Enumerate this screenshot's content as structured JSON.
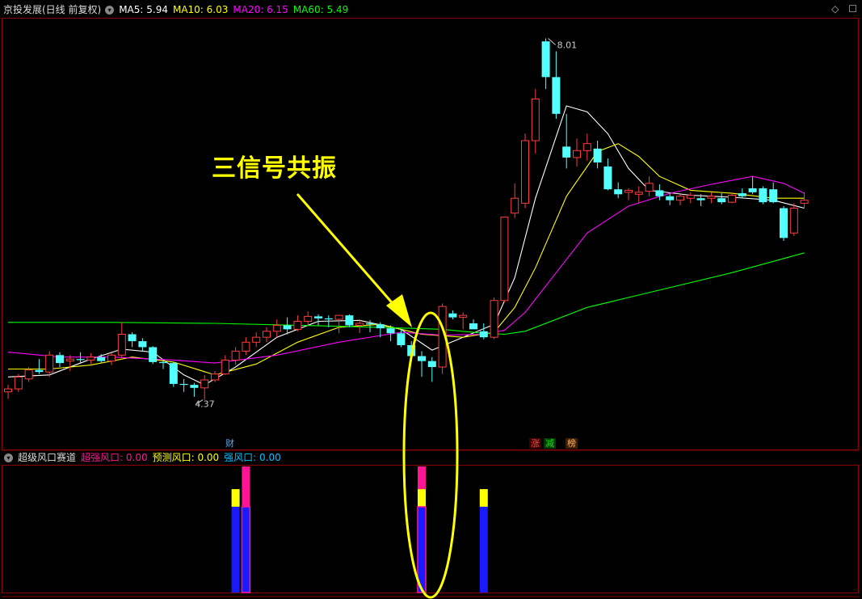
{
  "main_header": {
    "title": "京投发展(日线 前复权)",
    "ma5": "MA5: 5.94",
    "ma10": "MA10: 6.03",
    "ma20": "MA20: 6.15",
    "ma60": "MA60: 5.49"
  },
  "sub_header": {
    "title": "超级风口赛道",
    "s1": "超强风口: 0.00",
    "s2": "预测风口: 0.00",
    "s3": "强风口: 0.00"
  },
  "annotation": "三信号共振",
  "badges": {
    "cai": "财",
    "zhang": "涨",
    "jian": "减",
    "bang": "榜"
  },
  "colors": {
    "up": "#ff3c3c",
    "down": "#54ffff",
    "ma5": "#ffffff",
    "ma10": "#ffff00",
    "ma20": "#ff00ff",
    "ma60": "#00ff00",
    "superStrong": "#ff1493",
    "predict": "#ffff00",
    "strong": "#00bfff",
    "blue": "#1a1aff",
    "ellipse": "#ffff00"
  },
  "chart_data": {
    "type": "candlestick",
    "ylim": [
      4.0,
      8.25
    ],
    "price_labels": {
      "high": "8.01",
      "low": "4.37"
    },
    "candles": [
      [
        4.45,
        4.52,
        4.38,
        4.48
      ],
      [
        4.48,
        4.63,
        4.45,
        4.6
      ],
      [
        4.58,
        4.7,
        4.55,
        4.67
      ],
      [
        4.67,
        4.78,
        4.63,
        4.65
      ],
      [
        4.65,
        4.86,
        4.6,
        4.82
      ],
      [
        4.82,
        4.85,
        4.7,
        4.74
      ],
      [
        4.76,
        4.82,
        4.66,
        4.78
      ],
      [
        4.78,
        4.85,
        4.74,
        4.77
      ],
      [
        4.77,
        4.84,
        4.73,
        4.8
      ],
      [
        4.8,
        4.83,
        4.74,
        4.76
      ],
      [
        4.76,
        4.84,
        4.72,
        4.82
      ],
      [
        4.82,
        5.15,
        4.8,
        5.03
      ],
      [
        5.03,
        5.05,
        4.9,
        4.96
      ],
      [
        4.96,
        4.99,
        4.86,
        4.9
      ],
      [
        4.9,
        4.91,
        4.73,
        4.75
      ],
      [
        4.75,
        4.77,
        4.68,
        4.74
      ],
      [
        4.74,
        4.75,
        4.5,
        4.53
      ],
      [
        4.53,
        4.58,
        4.45,
        4.52
      ],
      [
        4.52,
        4.54,
        4.4,
        4.49
      ],
      [
        4.49,
        4.62,
        4.37,
        4.57
      ],
      [
        4.57,
        4.66,
        4.55,
        4.63
      ],
      [
        4.63,
        4.82,
        4.62,
        4.77
      ],
      [
        4.77,
        4.9,
        4.72,
        4.86
      ],
      [
        4.86,
        5.0,
        4.82,
        4.95
      ],
      [
        4.95,
        5.05,
        4.9,
        5.0
      ],
      [
        5.0,
        5.1,
        4.95,
        5.06
      ],
      [
        5.06,
        5.18,
        5.0,
        5.12
      ],
      [
        5.12,
        5.2,
        5.03,
        5.08
      ],
      [
        5.08,
        5.22,
        5.06,
        5.16
      ],
      [
        5.16,
        5.26,
        5.12,
        5.21
      ],
      [
        5.21,
        5.23,
        5.12,
        5.19
      ],
      [
        5.19,
        5.22,
        5.1,
        5.18
      ],
      [
        5.18,
        5.2,
        5.04,
        5.22
      ],
      [
        5.22,
        5.23,
        5.1,
        5.12
      ],
      [
        5.12,
        5.18,
        5.04,
        5.14
      ],
      [
        5.14,
        5.17,
        5.05,
        5.13
      ],
      [
        5.13,
        5.15,
        5.0,
        5.09
      ],
      [
        5.09,
        5.12,
        4.96,
        5.04
      ],
      [
        5.04,
        5.08,
        4.9,
        4.92
      ],
      [
        4.92,
        4.96,
        4.75,
        4.81
      ],
      [
        4.81,
        4.86,
        4.6,
        4.76
      ],
      [
        4.76,
        4.8,
        4.55,
        4.7
      ],
      [
        4.7,
        5.34,
        4.63,
        5.31
      ],
      [
        5.24,
        5.27,
        5.18,
        5.2
      ],
      [
        5.2,
        5.25,
        5.08,
        5.22
      ],
      [
        5.14,
        5.18,
        5.08,
        5.08
      ],
      [
        5.06,
        5.14,
        4.98,
        5.0
      ],
      [
        5.0,
        5.4,
        4.98,
        5.37
      ],
      [
        5.37,
        6.2,
        5.35,
        6.21
      ],
      [
        6.25,
        6.55,
        6.2,
        6.4
      ],
      [
        6.35,
        7.05,
        6.3,
        6.98
      ],
      [
        6.98,
        7.5,
        6.85,
        7.4
      ],
      [
        7.98,
        8.01,
        7.5,
        7.62
      ],
      [
        7.62,
        7.88,
        7.2,
        7.25
      ],
      [
        6.92,
        7.25,
        6.7,
        6.81
      ],
      [
        6.81,
        7.0,
        6.72,
        6.88
      ],
      [
        6.88,
        7.05,
        6.78,
        6.95
      ],
      [
        6.9,
        6.98,
        6.7,
        6.76
      ],
      [
        6.72,
        6.8,
        6.48,
        6.49
      ],
      [
        6.49,
        6.56,
        6.4,
        6.44
      ],
      [
        6.46,
        6.5,
        6.38,
        6.48
      ],
      [
        6.44,
        6.52,
        6.35,
        6.46
      ],
      [
        6.47,
        6.62,
        6.42,
        6.55
      ],
      [
        6.48,
        6.54,
        6.38,
        6.42
      ],
      [
        6.42,
        6.45,
        6.33,
        6.38
      ],
      [
        6.38,
        6.44,
        6.33,
        6.42
      ],
      [
        6.4,
        6.46,
        6.35,
        6.43
      ],
      [
        6.4,
        6.44,
        6.32,
        6.38
      ],
      [
        6.4,
        6.46,
        6.35,
        6.42
      ],
      [
        6.4,
        6.45,
        6.34,
        6.36
      ],
      [
        6.36,
        6.46,
        6.35,
        6.43
      ],
      [
        6.45,
        6.5,
        6.4,
        6.42
      ],
      [
        6.5,
        6.62,
        6.44,
        6.46
      ],
      [
        6.5,
        6.52,
        6.34,
        6.36
      ],
      [
        6.49,
        6.56,
        6.35,
        6.36
      ],
      [
        6.3,
        6.32,
        5.97,
        6.0
      ],
      [
        6.05,
        6.35,
        6.02,
        6.3
      ],
      [
        6.35,
        6.46,
        6.3,
        6.38
      ]
    ],
    "ma_series": [
      {
        "name": "MA5",
        "color": "#ffffff",
        "points": [
          [
            0,
            4.6
          ],
          [
            4,
            4.62
          ],
          [
            8,
            4.78
          ],
          [
            11,
            4.88
          ],
          [
            14,
            4.85
          ],
          [
            17,
            4.62
          ],
          [
            19,
            4.52
          ],
          [
            22,
            4.7
          ],
          [
            26,
            5.0
          ],
          [
            30,
            5.16
          ],
          [
            34,
            5.17
          ],
          [
            38,
            5.08
          ],
          [
            41,
            4.87
          ],
          [
            44,
            5.0
          ],
          [
            47,
            5.13
          ],
          [
            49,
            5.6
          ],
          [
            51,
            6.4
          ],
          [
            54,
            7.33
          ],
          [
            56,
            7.27
          ],
          [
            58,
            7.05
          ],
          [
            60,
            6.7
          ],
          [
            62,
            6.48
          ],
          [
            66,
            6.43
          ],
          [
            70,
            6.41
          ],
          [
            74,
            6.38
          ],
          [
            77,
            6.3
          ]
        ]
      },
      {
        "name": "MA10",
        "color": "#ffff00",
        "points": [
          [
            0,
            4.68
          ],
          [
            4,
            4.68
          ],
          [
            8,
            4.72
          ],
          [
            12,
            4.8
          ],
          [
            16,
            4.75
          ],
          [
            20,
            4.62
          ],
          [
            24,
            4.73
          ],
          [
            28,
            4.95
          ],
          [
            32,
            5.1
          ],
          [
            36,
            5.13
          ],
          [
            40,
            5.03
          ],
          [
            44,
            5.0
          ],
          [
            47,
            5.05
          ],
          [
            49,
            5.3
          ],
          [
            51,
            5.7
          ],
          [
            54,
            6.42
          ],
          [
            57,
            6.87
          ],
          [
            59,
            6.95
          ],
          [
            61,
            6.82
          ],
          [
            63,
            6.62
          ],
          [
            66,
            6.48
          ],
          [
            70,
            6.45
          ],
          [
            74,
            6.4
          ],
          [
            77,
            6.4
          ]
        ]
      },
      {
        "name": "MA20",
        "color": "#ff00ff",
        "points": [
          [
            0,
            4.85
          ],
          [
            5,
            4.8
          ],
          [
            10,
            4.8
          ],
          [
            16,
            4.77
          ],
          [
            20,
            4.74
          ],
          [
            26,
            4.82
          ],
          [
            32,
            4.95
          ],
          [
            38,
            5.05
          ],
          [
            42,
            5.02
          ],
          [
            46,
            5.03
          ],
          [
            48,
            5.07
          ],
          [
            50,
            5.25
          ],
          [
            53,
            5.65
          ],
          [
            56,
            6.05
          ],
          [
            60,
            6.32
          ],
          [
            64,
            6.45
          ],
          [
            68,
            6.54
          ],
          [
            72,
            6.62
          ],
          [
            75,
            6.55
          ],
          [
            77,
            6.45
          ]
        ]
      },
      {
        "name": "MA60",
        "color": "#00ff00",
        "points": [
          [
            0,
            5.15
          ],
          [
            10,
            5.15
          ],
          [
            20,
            5.14
          ],
          [
            28,
            5.12
          ],
          [
            36,
            5.1
          ],
          [
            42,
            5.08
          ],
          [
            46,
            5.04
          ],
          [
            48,
            5.03
          ],
          [
            50,
            5.06
          ],
          [
            56,
            5.3
          ],
          [
            62,
            5.45
          ],
          [
            70,
            5.65
          ],
          [
            77,
            5.85
          ]
        ]
      }
    ],
    "indicator": {
      "title": "超级风口赛道",
      "series": [
        {
          "name": "超强风口",
          "color": "#ff1493",
          "bars": [
            {
              "i": 23,
              "top": 1.0,
              "bottom": 0.68
            },
            {
              "i": 40,
              "top": 1.0,
              "bottom": 0.82
            }
          ]
        },
        {
          "name": "预测风口",
          "color": "#ffff00",
          "bars": [
            {
              "i": 22,
              "top": 0.82,
              "bottom": 0.68
            },
            {
              "i": 40,
              "top": 0.82,
              "bottom": 0.68
            },
            {
              "i": 46,
              "top": 0.82,
              "bottom": 0.68
            }
          ]
        },
        {
          "name": "强风口",
          "color": "#1a1aff",
          "bars": [
            {
              "i": 22,
              "top": 0.68,
              "bottom": 0.0
            },
            {
              "i": 23,
              "top": 0.68,
              "bottom": 0.0
            },
            {
              "i": 40,
              "top": 0.68,
              "bottom": 0.0
            },
            {
              "i": 46,
              "top": 0.68,
              "bottom": 0.0
            }
          ]
        }
      ]
    }
  }
}
